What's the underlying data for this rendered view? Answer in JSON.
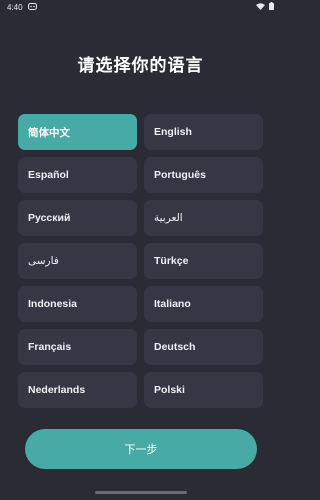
{
  "status_bar": {
    "time": "4:40",
    "icons": [
      "notification-icon",
      "wifi-icon",
      "battery-icon"
    ]
  },
  "title": "请选择你的语言",
  "languages": [
    {
      "label": "简体中文",
      "selected": true,
      "rtl": false
    },
    {
      "label": "English",
      "selected": false,
      "rtl": false
    },
    {
      "label": "Español",
      "selected": false,
      "rtl": false
    },
    {
      "label": "Português",
      "selected": false,
      "rtl": false
    },
    {
      "label": "Русский",
      "selected": false,
      "rtl": false
    },
    {
      "label": "العربية",
      "selected": false,
      "rtl": true
    },
    {
      "label": "فارسی",
      "selected": false,
      "rtl": true
    },
    {
      "label": "Türkçe",
      "selected": false,
      "rtl": false
    },
    {
      "label": "Indonesia",
      "selected": false,
      "rtl": false
    },
    {
      "label": "Italiano",
      "selected": false,
      "rtl": false
    },
    {
      "label": "Français",
      "selected": false,
      "rtl": false
    },
    {
      "label": "Deutsch",
      "selected": false,
      "rtl": false
    },
    {
      "label": "Nederlands",
      "selected": false,
      "rtl": false
    },
    {
      "label": "Polski",
      "selected": false,
      "rtl": false
    }
  ],
  "next_button": "下一步",
  "colors": {
    "background": "#2a2b35",
    "tile": "#363744",
    "accent": "#47aaa5"
  }
}
